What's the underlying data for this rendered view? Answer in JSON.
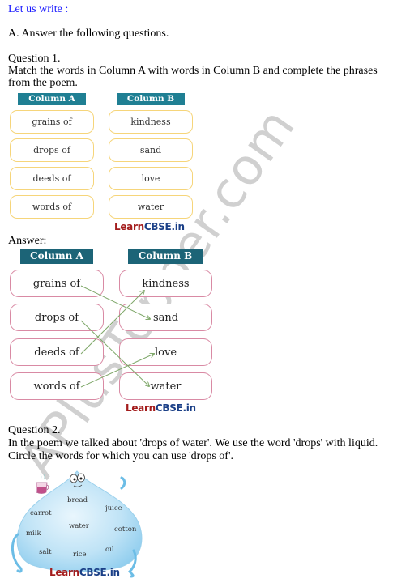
{
  "section_title": "Let us write :",
  "instruction": "A. Answer the following questions.",
  "question1": {
    "label": "Question 1.",
    "text_line1": "Match the words in Column A with words in Column B and complete the phrases",
    "text_line2": "from the poem.",
    "column_a_header": "Column A",
    "column_b_header": "Column B",
    "column_a": [
      "grains of",
      "drops of",
      "deeds of",
      "words of"
    ],
    "column_b": [
      "kindness",
      "sand",
      "love",
      "water"
    ],
    "brand_learn": "Learn",
    "brand_cbse": "CBSE.in"
  },
  "answer1": {
    "label": "Answer:",
    "column_a_header": "Column A",
    "column_b_header": "Column B",
    "column_a": [
      "grains of",
      "drops of",
      "deeds of",
      "words of"
    ],
    "column_b": [
      "kindness",
      "sand",
      "love",
      "water"
    ],
    "matches": [
      {
        "from": "grains of",
        "to": "sand"
      },
      {
        "from": "drops of",
        "to": "water"
      },
      {
        "from": "deeds of",
        "to": "kindness"
      },
      {
        "from": "words of",
        "to": "love"
      }
    ],
    "line_color": "#7fa86a",
    "brand_learn": "Learn",
    "brand_cbse": "CBSE.in"
  },
  "question2": {
    "label": "Question 2.",
    "text_line1": "In the poem we talked about 'drops of water'. We use the word 'drops' with liquid.",
    "text_line2": "Circle the words for which you can use 'drops of'.",
    "drop_words": [
      "bread",
      "juice",
      "carrot",
      "water",
      "cotton",
      "milk",
      "salt",
      "rice",
      "oil"
    ],
    "brand_learn": "Learn",
    "brand_cbse": "CBSE.in"
  },
  "watermark": "APlusTopper.com",
  "colors": {
    "title_blue": "#1a1aff",
    "header_teal": "#1f7f93",
    "box_yellow": "#f6d57a",
    "box_pink": "#d98aa4",
    "drop_blue": "#a9d8f2"
  }
}
